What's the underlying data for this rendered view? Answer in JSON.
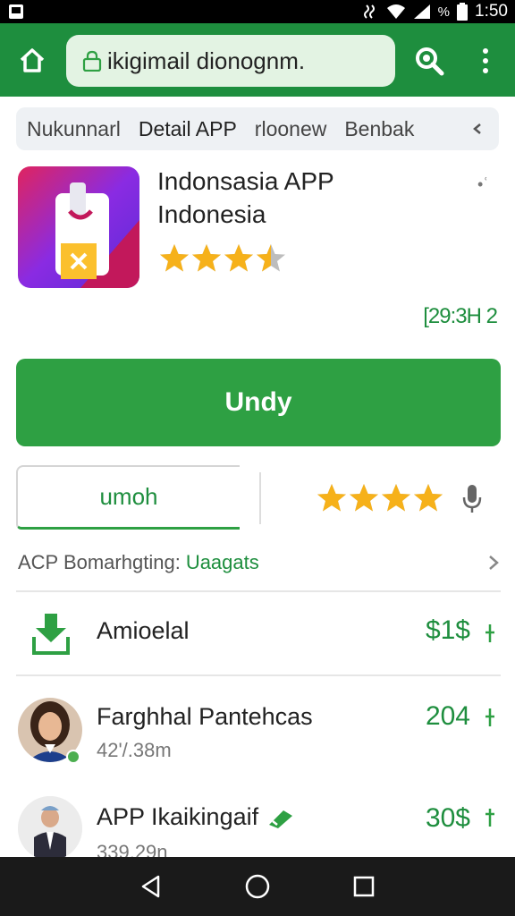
{
  "status": {
    "time": "1:50",
    "battery": "%"
  },
  "browser": {
    "url": "ikigimail dionognm."
  },
  "tabs": [
    "Nukunnarl",
    "Detail APP",
    "rloonew",
    "Benbak"
  ],
  "app": {
    "title_line1": "Indonsasia APP",
    "title_line2": "Indonesia",
    "more": "•ʿ",
    "rating": 3.5,
    "size_label": "[29:3H 2"
  },
  "actions": {
    "install_label": "Undy",
    "open_label": "umoh",
    "rating_count": 4
  },
  "info": {
    "label": "ACP Bomarhgting:",
    "value": "Uaagats"
  },
  "list": [
    {
      "title": "Amioelal",
      "sub": "",
      "value": "$1$"
    },
    {
      "title": "Farghhal Pantehcas",
      "sub": "42'/.38m",
      "value": "204"
    },
    {
      "title": "APP Ikaikingaif",
      "sub": "339.29n",
      "value": "30$"
    }
  ],
  "colors": {
    "brand": "#1e8e3e",
    "button": "#2ea043",
    "star": "#f6b11a",
    "star_empty": "#bdbdbd"
  }
}
